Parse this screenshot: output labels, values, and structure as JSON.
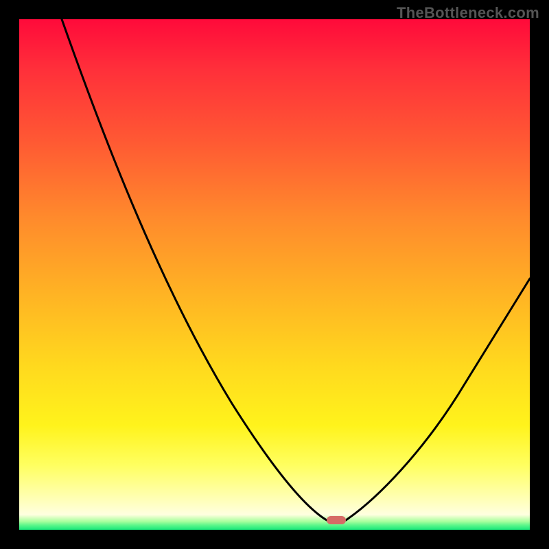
{
  "watermark": "TheBottleneck.com",
  "chart_data": {
    "type": "line",
    "title": "",
    "xlabel": "",
    "ylabel": "",
    "xlim": [
      0,
      100
    ],
    "ylim": [
      0,
      100
    ],
    "grid": false,
    "legend": false,
    "background_gradient": {
      "direction": "vertical",
      "stops": [
        {
          "pos": 0.0,
          "color": "#ff0a3a"
        },
        {
          "pos": 0.25,
          "color": "#ff5a33"
        },
        {
          "pos": 0.55,
          "color": "#ffb224"
        },
        {
          "pos": 0.82,
          "color": "#fff31c"
        },
        {
          "pos": 0.95,
          "color": "#ffffb8"
        },
        {
          "pos": 0.975,
          "color": "#d8ffc0"
        },
        {
          "pos": 1.0,
          "color": "#18e77a"
        }
      ]
    },
    "series": [
      {
        "name": "bottleneck-curve",
        "x": [
          8,
          15,
          25,
          35,
          45,
          55,
          60,
          62,
          65,
          72,
          82,
          92,
          100
        ],
        "y": [
          100,
          80,
          58,
          40,
          24,
          10,
          3,
          1,
          3,
          12,
          28,
          42,
          50
        ]
      }
    ],
    "annotations": [
      {
        "name": "optimum-marker",
        "shape": "rounded-rect",
        "x": 62,
        "y": 1,
        "color": "#d66b66"
      }
    ]
  }
}
